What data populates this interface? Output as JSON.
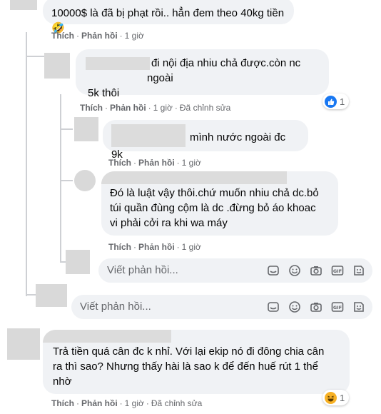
{
  "actions": {
    "like": "Thích",
    "reply": "Phản hồi",
    "dot": "·",
    "edited": "Đã chỉnh sửa"
  },
  "comments": [
    {
      "text": "10000$ là đã bị phạt rồi.. hẳn đem theo 40kg tiền",
      "emoji": "🤣",
      "time": "1 giờ"
    },
    {
      "line1": "đi nội địa nhiu chả được.còn nc ngoài",
      "line2": "5k thôi",
      "time": "1 giờ",
      "edited": true,
      "reaction_count": "1"
    },
    {
      "text": "mình nước ngoài đc 9k",
      "time": "1 giờ"
    },
    {
      "line1": "Đó là luật vậy thôi.chứ muốn nhiu chả dc.bỏ",
      "line2": "túi quần đùng cộm là dc .đừng bỏ áo khoac",
      "line3": "vi phải cởi ra khi wa máy",
      "time": "1 giờ"
    },
    {
      "line1": "Trả tiền quá cân đc k nhỉ. Với lại ekip nó đi đông chia cân",
      "line2": "ra thì sao? Nhưng thấy hài là sao k để đến huế rút 1 thể",
      "line3": "nhờ",
      "time": "1 giờ",
      "edited": true,
      "reaction_count": "1"
    }
  ],
  "reply_placeholder": "Viết phản hồi...",
  "icons": [
    "sticker-icon",
    "emoji-icon",
    "camera-icon",
    "gif-icon",
    "sticker-face-icon"
  ],
  "colors": {
    "like_blue": "#1877f2",
    "haha_yellow": "#f7b125",
    "bubble": "#f0f2f5",
    "meta": "#65676b"
  }
}
